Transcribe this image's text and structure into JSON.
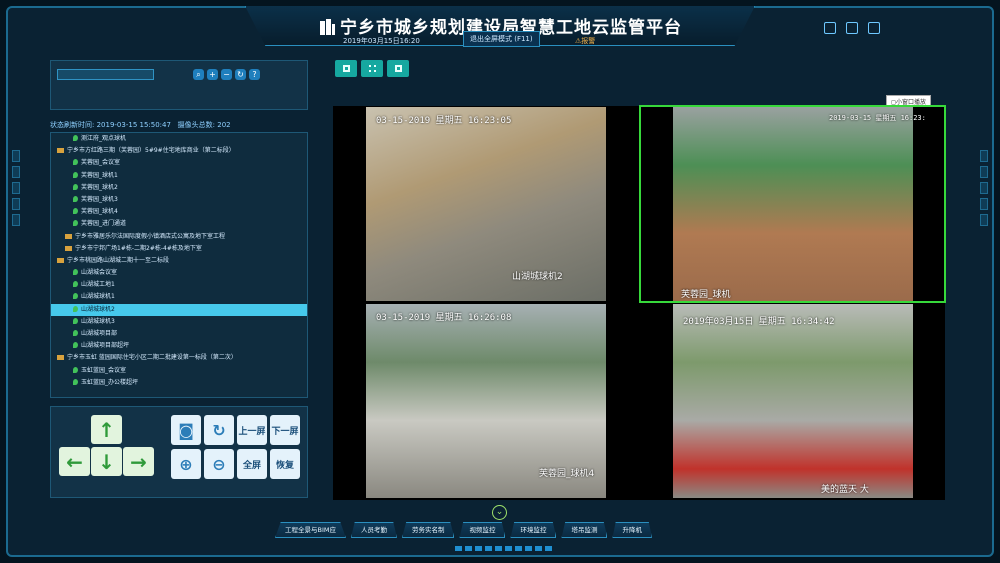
{
  "header": {
    "title": "宁乡市城乡规划建设局智慧工地云监管平台",
    "datetime": "2019年03月15日16:20",
    "exit_label": "退出全屏模式 (F11)",
    "alarm_label": "报警"
  },
  "toolbar": {
    "search_placeholder": "",
    "buttons": [
      "search-icon",
      "plus-icon",
      "minus-icon",
      "refresh-icon",
      "help-icon"
    ]
  },
  "status": {
    "refresh_label": "状态刷新时间:",
    "refresh_time": "2019-03-15 15:50:47",
    "count_label": "摄像头总数:",
    "count": "202"
  },
  "tree": [
    {
      "type": "dev",
      "indent": 2,
      "label": "测江府_观点球机"
    },
    {
      "type": "grp",
      "indent": 0,
      "label": "宁乡市方红路三期（芙蓉园）5#9#住宅地库商业（第二标段）"
    },
    {
      "type": "dev",
      "indent": 2,
      "label": "芙蓉园_会议室"
    },
    {
      "type": "dev",
      "indent": 2,
      "label": "芙蓉园_球机1"
    },
    {
      "type": "dev",
      "indent": 2,
      "label": "芙蓉园_球机2"
    },
    {
      "type": "dev",
      "indent": 2,
      "label": "芙蓉园_球机3"
    },
    {
      "type": "dev",
      "indent": 2,
      "label": "芙蓉园_球机4"
    },
    {
      "type": "dev",
      "indent": 2,
      "label": "芙蓉园_进门通道"
    },
    {
      "type": "grp",
      "indent": 1,
      "label": "宁乡市雅居乐尔法国际度假小镇酒店式公寓及地下室工程"
    },
    {
      "type": "grp",
      "indent": 1,
      "label": "宁乡市宁邦广场1#栋-二期2#栋-4#栋及地下室"
    },
    {
      "type": "grp",
      "indent": 0,
      "label": "宁乡市桃园路山湖城二期十一至二标段"
    },
    {
      "type": "dev",
      "indent": 2,
      "label": "山湖城会议室"
    },
    {
      "type": "dev",
      "indent": 2,
      "label": "山湖城工地1"
    },
    {
      "type": "dev",
      "indent": 2,
      "label": "山湖城球机1"
    },
    {
      "type": "dev",
      "indent": 2,
      "label": "山湖城球机2",
      "selected": true
    },
    {
      "type": "dev",
      "indent": 2,
      "label": "山湖城球机3"
    },
    {
      "type": "dev",
      "indent": 2,
      "label": "山湖城项目部"
    },
    {
      "type": "dev",
      "indent": 2,
      "label": "山湖城项目部超坪"
    },
    {
      "type": "grp",
      "indent": 0,
      "label": "宁乡市玉虹 蓝园国际住宅小区二期二批建设第一标段（第二次）"
    },
    {
      "type": "dev",
      "indent": 2,
      "label": "玉虹蓝园_会议室"
    },
    {
      "type": "dev",
      "indent": 2,
      "label": "玉虹蓝园_办公楼超坪"
    }
  ],
  "controls": {
    "prev_screen": "上一屏",
    "next_screen": "下一屏",
    "fullscreen": "全屏",
    "restore": "恢复"
  },
  "small_window": "小窗口播放",
  "videos": [
    {
      "osd": "03-15-2019 星期五 16:23:05",
      "camera": "山湖城球机2"
    },
    {
      "osd": "2019-03-15 星期五 16:23:",
      "camera": "芙蓉园_球机"
    },
    {
      "osd": "03-15-2019 星期五 16:26:08",
      "camera": "芙蓉园_球机4"
    },
    {
      "osd": "2019年03月15日 星期五 16:34:42",
      "camera": "美的蓝天 大"
    }
  ],
  "bottom_nav": [
    "工程全景与BIM应",
    "人员考勤",
    "劳务实名制",
    "视频监控",
    "环境监控",
    "塔吊监测",
    "升降机"
  ]
}
